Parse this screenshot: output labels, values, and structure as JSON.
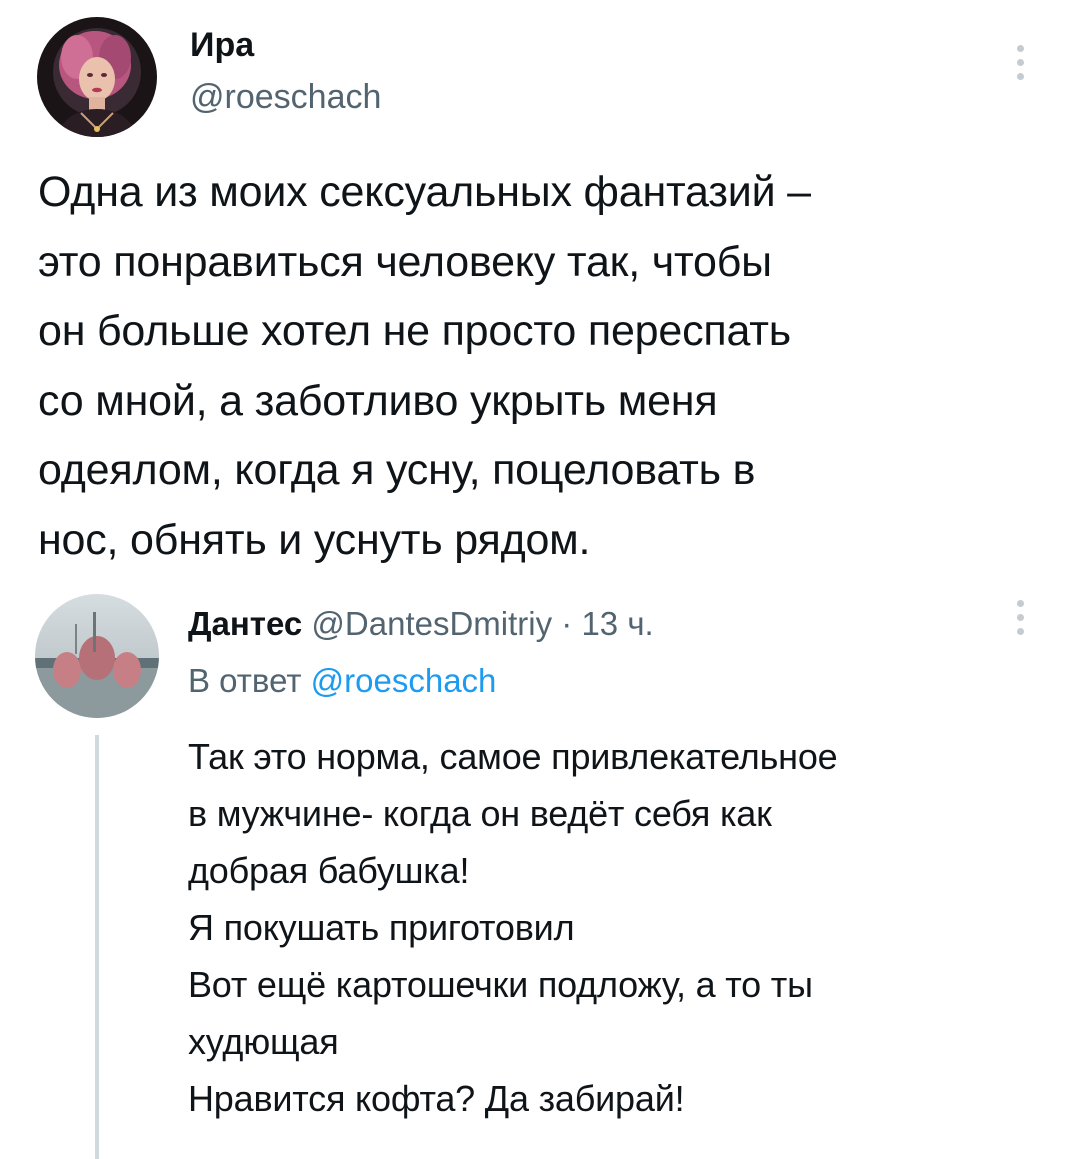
{
  "main_tweet": {
    "author_name": "Ира",
    "author_handle": "@roeschach",
    "text": "Одна из моих сексуальных фантазий –\nэто понравиться человеку так, чтобы\nон больше хотел не просто переспать\nсо мной, а заботливо укрыть меня\nодеялом, когда я усну, поцеловать в\nнос, обнять и уснуть рядом."
  },
  "reply_tweet": {
    "author_name": "Дантес",
    "author_handle": "@DantesDmitriy",
    "separator": "·",
    "time": "13 ч.",
    "reply_to_label": "В ответ",
    "reply_to_handle": "@roeschach",
    "text": "Так это норма, самое привлекательное\nв мужчине- когда он ведёт себя как\nдобрая бабушка!\nЯ покушать приготовил\nВот ещё картошечки подложу, а то ты\nхудющая\nНравится кофта? Да забирай!"
  },
  "icons": {
    "more": "more-vertical-icon",
    "main_avatar": "avatar-image",
    "reply_avatar": "avatar-image"
  },
  "colors": {
    "text_primary": "#0f1419",
    "text_secondary": "#536471",
    "link": "#1d9bf0",
    "thread_line": "#cfd9de"
  }
}
